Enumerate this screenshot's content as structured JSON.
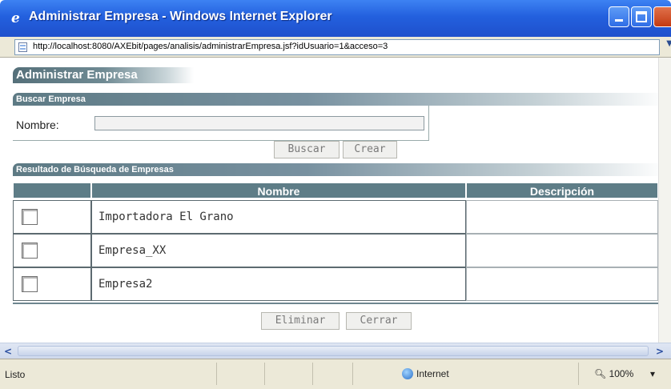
{
  "window": {
    "title": "Administrar Empresa - Windows Internet Explorer",
    "icon": "ie-logo-icon"
  },
  "address": {
    "url": "http://localhost:8080/AXEbit/pages/analisis/administrarEmpresa.jsf?idUsuario=1&acceso=3"
  },
  "page": {
    "title": "Administrar Empresa",
    "search_section": "Buscar Empresa",
    "nombre_label": "Nombre:",
    "nombre_value": "",
    "buscar_label": "Buscar",
    "crear_label": "Crear",
    "results_section": "Resultado de Búsqueda de Empresas",
    "eliminar_label": "Eliminar",
    "cerrar_label": "Cerrar"
  },
  "table": {
    "columns": [
      "",
      "Nombre",
      "Descripción"
    ],
    "rows": [
      {
        "checked": false,
        "nombre": "Importadora El Grano",
        "descripcion": ""
      },
      {
        "checked": false,
        "nombre": "Empresa_XX",
        "descripcion": ""
      },
      {
        "checked": false,
        "nombre": "Empresa2",
        "descripcion": ""
      }
    ]
  },
  "status": {
    "text": "Listo",
    "zone": "Internet",
    "zoom": "100%"
  },
  "colors": {
    "titlebar": "#2360de",
    "header_bg": "#5e7d87"
  }
}
